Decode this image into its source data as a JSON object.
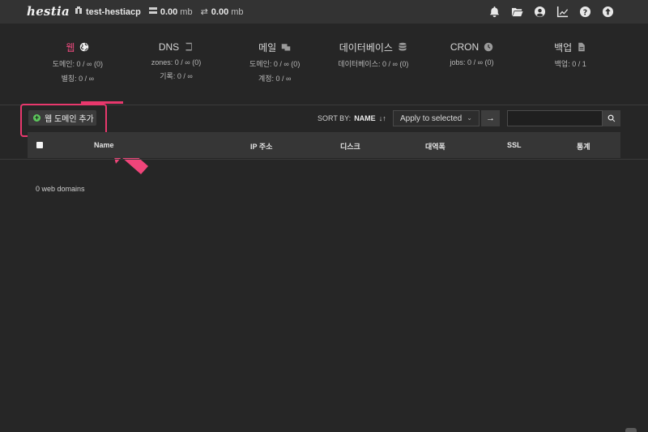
{
  "app": {
    "logo": "hestia"
  },
  "topbar": {
    "hostname": "test-hestiacp",
    "disk": {
      "value": "0.00",
      "unit": "mb"
    },
    "bandwidth": {
      "value": "0.00",
      "unit": "mb"
    },
    "icons": [
      "bell-icon",
      "folder-icon",
      "user-icon",
      "chart-icon",
      "help-icon",
      "upload-icon"
    ]
  },
  "stats": [
    {
      "title": "웹",
      "icon": "globe-icon",
      "lines": [
        "도메인: 0 / ∞ (0)",
        "별칭: 0 / ∞"
      ]
    },
    {
      "title": "DNS",
      "icon": "book-icon",
      "lines": [
        "zones: 0 / ∞ (0)",
        "기록: 0 / ∞"
      ]
    },
    {
      "title": "메일",
      "icon": "mail-icon",
      "lines": [
        "도메인: 0 / ∞ (0)",
        "계정: 0 / ∞"
      ]
    },
    {
      "title": "데이터베이스",
      "icon": "database-icon",
      "lines": [
        "데이터베이스: 0 / ∞ (0)"
      ]
    },
    {
      "title": "CRON",
      "icon": "clock-icon",
      "lines": [
        "jobs: 0 / ∞ (0)"
      ]
    },
    {
      "title": "백업",
      "icon": "file-icon",
      "lines": [
        "백업: 0 / 1"
      ]
    }
  ],
  "toolbar": {
    "add_label": "웹 도메인 추가",
    "sort_by_label": "SORT BY:",
    "sort_value": "NAME",
    "sort_icon": "↓↑",
    "apply_selected": "Apply to selected",
    "apply_chevron": "⌄",
    "go_arrow": "→"
  },
  "table": {
    "columns": [
      "Name",
      "IP 주소",
      "디스크",
      "대역폭",
      "SSL",
      "통계"
    ]
  },
  "empty_message": "0 web domains",
  "colors": {
    "accent": "#e8386d",
    "active_tab": "#e8497c",
    "add_icon": "#5cc75c"
  }
}
